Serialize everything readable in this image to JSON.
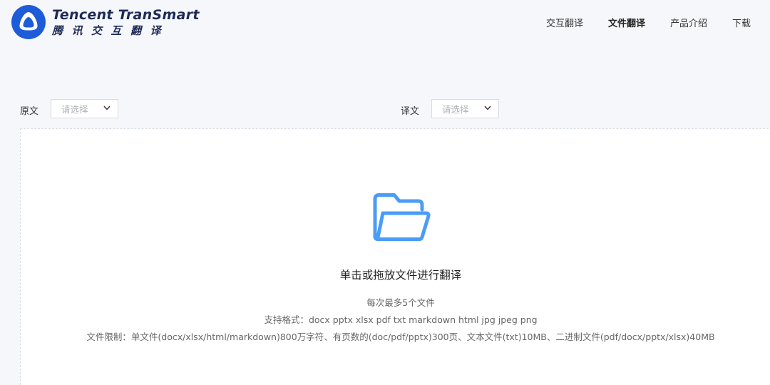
{
  "brand": {
    "name_en": "Tencent TranSmart",
    "name_cn": "腾讯交互翻译",
    "colors": {
      "primary": "#1d5bd8",
      "dark": "#1d2a55",
      "accent": "#4a9cf7"
    }
  },
  "nav": {
    "items": [
      {
        "label": "交互翻译",
        "active": false
      },
      {
        "label": "文件翻译",
        "active": true
      },
      {
        "label": "产品介绍",
        "active": false
      },
      {
        "label": "下载",
        "active": false
      }
    ]
  },
  "language": {
    "source": {
      "label": "原文",
      "placeholder": "请选择"
    },
    "target": {
      "label": "译文",
      "placeholder": "请选择"
    }
  },
  "upload": {
    "icon": "folder-open-icon",
    "title": "单击或拖放文件进行翻译",
    "max_files": "每次最多5个文件",
    "formats": "支持格式：docx pptx xlsx pdf txt markdown html jpg jpeg png",
    "limits": "文件限制：单文件(docx/xlsx/html/markdown)800万字符、有页数的(doc/pdf/pptx)300页、文本文件(txt)10MB、二进制文件(pdf/docx/pptx/xlsx)40MB"
  }
}
